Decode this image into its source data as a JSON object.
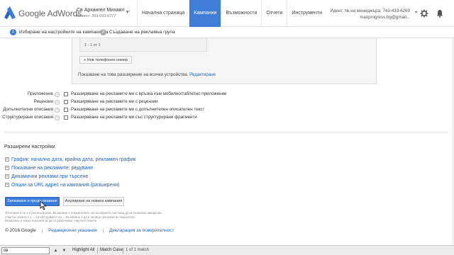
{
  "header": {
    "brand": "Google AdWords",
    "account_name": "Св Архангел Михаил ...",
    "account_id": "Клиент: 359-693-6777",
    "nav": [
      "Начална страница",
      "Кампании",
      "Възможности",
      "Отчети",
      "Инструменти"
    ],
    "active_nav_index": 1,
    "manager_line1": "Идент. № на мениджъра: 743-433-6269",
    "manager_line2": "maxprogress.bg@gmail...",
    "accent_color": "#3f7ed8"
  },
  "steps": [
    {
      "num": "1",
      "label": "Избиране на настройките на кампанията"
    },
    {
      "num": "2",
      "label": "Създаване на рекламна група"
    }
  ],
  "box": {
    "pager": "1 - 1 от 1",
    "add_phone_label": "+ Нов телефонен номер",
    "show_text": "Показване на това разширение на всички устройства.",
    "edit_link": "Редактиране"
  },
  "extensions": [
    {
      "label": "Приложение",
      "text": "Разширяване на рекламите ми с връзка към мобилно/таблетно приложение"
    },
    {
      "label": "Рецензии",
      "text": "Разширяване на рекламите ми с рецензии"
    },
    {
      "label": "Допълнителни описания",
      "text": "Разширяване на рекламите ми с допълнителен описателен текст"
    },
    {
      "label": "Структурирани описания",
      "text": "Разширяване на рекламите ми със структурирани фрагменти"
    }
  ],
  "advanced": {
    "title": "Разширени настройки",
    "items": [
      "График: начална дата, крайна дата, рекламен график",
      "Показване на рекламите: редуване",
      "Динамични реклами при търсене",
      "Опции за URL адрес на кампания (разширени)"
    ]
  },
  "buttons": {
    "save": "Запазване и продължаване",
    "cancel": "Анулиране на новата кампания"
  },
  "disclaimer": [
    "Отчитането не е в реално време. Възможно е показателите за последните три часа да не включват импресии...",
    "Участък зоната е в ... за настройките на ... Възможно е да е налице неотразени показатели.",
    "Възможно е някои показатели да се различават. Научете повече"
  ],
  "footer": {
    "copyright": "© 2016 Google",
    "link1": "Редакционни указания",
    "link2": "Декларация за поверителност"
  },
  "findbar": {
    "query": "св",
    "highlight": "Highlight All",
    "match_case": "Match Case",
    "count": "1 of 1 match"
  }
}
